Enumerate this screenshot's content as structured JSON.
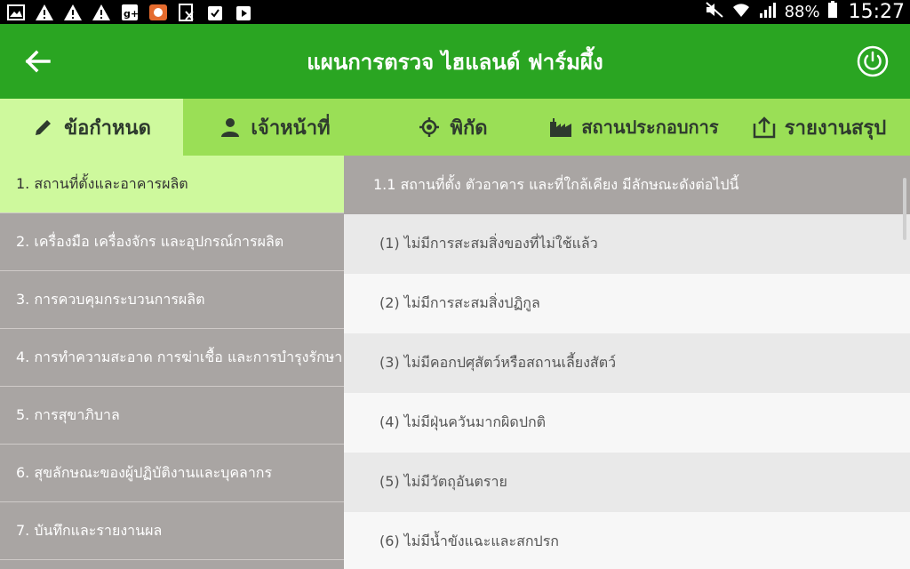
{
  "status_bar": {
    "notification_icons": [
      "picture-icon",
      "warning-icon",
      "warning-icon",
      "warning-icon",
      "google-plus-icon",
      "app-icon",
      "excel-icon",
      "clipboard-check-icon",
      "play-store-icon"
    ],
    "battery": "88%",
    "time": "15:27"
  },
  "app_bar": {
    "title": "แผนการตรวจ ไฮแลนด์ ฟาร์มผึ้ง"
  },
  "tabs": [
    {
      "label": "ข้อกำหนด",
      "icon": "pencil-icon",
      "active": true
    },
    {
      "label": "เจ้าหน้าที่",
      "icon": "person-icon",
      "active": false
    },
    {
      "label": "พิกัด",
      "icon": "crosshair-icon",
      "active": false
    },
    {
      "label": "สถานประกอบการ",
      "icon": "factory-icon",
      "active": false
    },
    {
      "label": "รายงานสรุป",
      "icon": "upload-icon",
      "active": false
    }
  ],
  "left_list": [
    "1. สถานที่ตั้งและอาคารผลิต",
    "2.  เครื่องมือ เครื่องจักร และอุปกรณ์การผลิต",
    "3. การควบคุมกระบวนการผลิต",
    "4. การทำความสะอาด การฆ่าเชื้อ และการบำรุงรักษา",
    "5. การสุขาภิบาล",
    "6. สุขลักษณะของผู้ปฏิบัติงานและบุคลากร",
    "7. บันทึกและรายงานผล"
  ],
  "section_header": "1.1 สถานที่ตั้ง ตัวอาคาร และที่ใกล้เคียง มีลักษณะดังต่อไปนี้",
  "right_items": [
    "(1) ไม่มีการสะสมสิ่งของที่ไม่ใช้แล้ว",
    "(2) ไม่มีการสะสมสิ่งปฏิกูล",
    "(3) ไม่มีคอกปศุสัตว์หรือสถานเลี้ยงสัตว์",
    "(4) ไม่มีฝุ่นควันมากผิดปกติ",
    "(5) ไม่มีวัตถุอันตราย",
    "(6) ไม่มีน้ำขังแฉะและสกปรก"
  ],
  "colors": {
    "app_bar": "#2aa522",
    "tab_bar": "#9adf56",
    "tab_active": "#cef99d",
    "list_grey": "#a9a5a3"
  }
}
